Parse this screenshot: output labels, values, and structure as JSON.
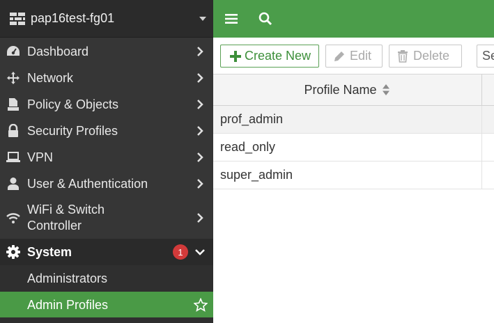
{
  "device": {
    "name": "pap16test-fg01",
    "icon": "firewall-icon"
  },
  "sidebar": {
    "items": [
      {
        "label": "Dashboard",
        "icon": "dashboard-icon"
      },
      {
        "label": "Network",
        "icon": "network-move-icon"
      },
      {
        "label": "Policy & Objects",
        "icon": "policy-icon"
      },
      {
        "label": "Security Profiles",
        "icon": "lock-icon"
      },
      {
        "label": "VPN",
        "icon": "laptop-icon"
      },
      {
        "label": "User & Authentication",
        "icon": "user-icon"
      },
      {
        "label": "WiFi & Switch Controller",
        "icon": "wifi-icon"
      }
    ],
    "system": {
      "label": "System",
      "icon": "gear-icon",
      "badge": "1"
    },
    "subitems": [
      {
        "label": "Administrators"
      },
      {
        "label": "Admin Profiles",
        "active": true
      }
    ]
  },
  "topbar": {
    "menu_icon": "hamburger-icon",
    "search_icon": "search-icon"
  },
  "toolbar": {
    "create_label": "Create New",
    "edit_label": "Edit",
    "delete_label": "Delete",
    "search_placeholder": "Search"
  },
  "table": {
    "columns": [
      "Profile Name"
    ],
    "rows": [
      "prof_admin",
      "read_only",
      "super_admin"
    ]
  },
  "colors": {
    "accent_green": "#4b9d4a",
    "sidebar_bg": "#363636",
    "badge_red": "#d23a3a"
  }
}
